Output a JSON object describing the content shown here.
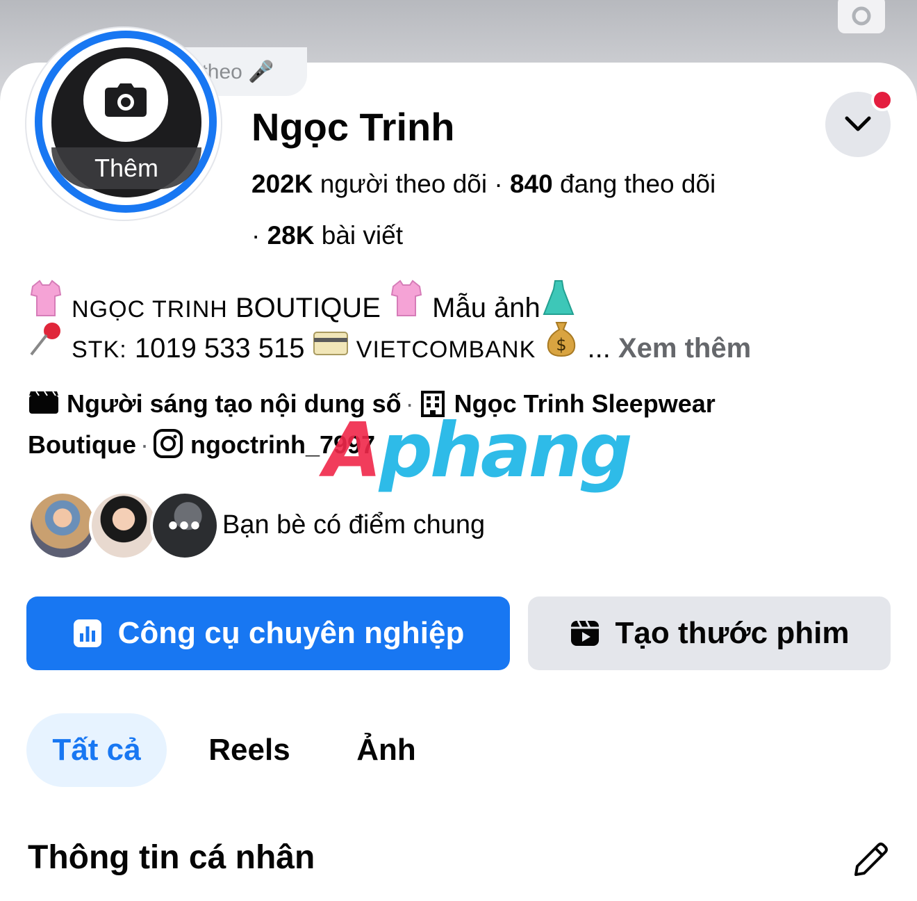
{
  "header": {
    "note_text": "Hát theo 🎤"
  },
  "profile": {
    "name": "Ngọc Trinh",
    "avatar_add_label": "Thêm",
    "followers_count": "202K",
    "followers_label": "người theo dõi",
    "following_count": "840",
    "following_label": "đang theo dõi",
    "posts_count": "28K",
    "posts_label": "bài viết"
  },
  "bio": {
    "line1_part1": "NGỌC TRINH",
    "line1_part2": "BOUTIQUE",
    "line1_part3": "Mẫu ảnh",
    "line2_part1": "STK:",
    "line2_account": "1019 533 515",
    "line2_bank": "VIETCOMBANK",
    "line2_ellipsis": "...",
    "see_more": "Xem thêm"
  },
  "meta": {
    "category": "Người sáng tạo nội dung số",
    "business_part1": "Ngọc Trinh Sleepwear",
    "business_part2": "Boutique",
    "instagram_handle": "ngoctrinh_7997",
    "separator": "·"
  },
  "watermark": {
    "text_a": "A",
    "text_rest": "phang"
  },
  "friends": {
    "more_label": "•••",
    "text": "Bạn bè có điểm chung"
  },
  "actions": {
    "primary_label": "Công cụ chuyên nghiệp",
    "secondary_label": "Tạo thước phim"
  },
  "tabs": [
    {
      "label": "Tất cả"
    },
    {
      "label": "Reels"
    },
    {
      "label": "Ảnh"
    }
  ],
  "section": {
    "title": "Thông tin cá nhân"
  },
  "colors": {
    "brand_blue": "#1877f2",
    "notification_red": "#e41e3f",
    "tab_active_bg": "#e7f3ff",
    "secondary_btn_bg": "#e4e6eb"
  },
  "icons": {
    "cover_camera": "camera-icon",
    "avatar_camera": "camera-icon",
    "dropdown": "chevron-down-icon",
    "tshirt": "tshirt-emoji",
    "dress": "dress-emoji",
    "pin": "pushpin-emoji",
    "card": "credit-card-emoji",
    "money": "money-bag-emoji",
    "creator": "clapperboard-icon",
    "business": "building-icon",
    "instagram": "instagram-icon",
    "pro_tools": "chart-icon",
    "reel": "reel-icon",
    "edit": "pencil-icon"
  }
}
